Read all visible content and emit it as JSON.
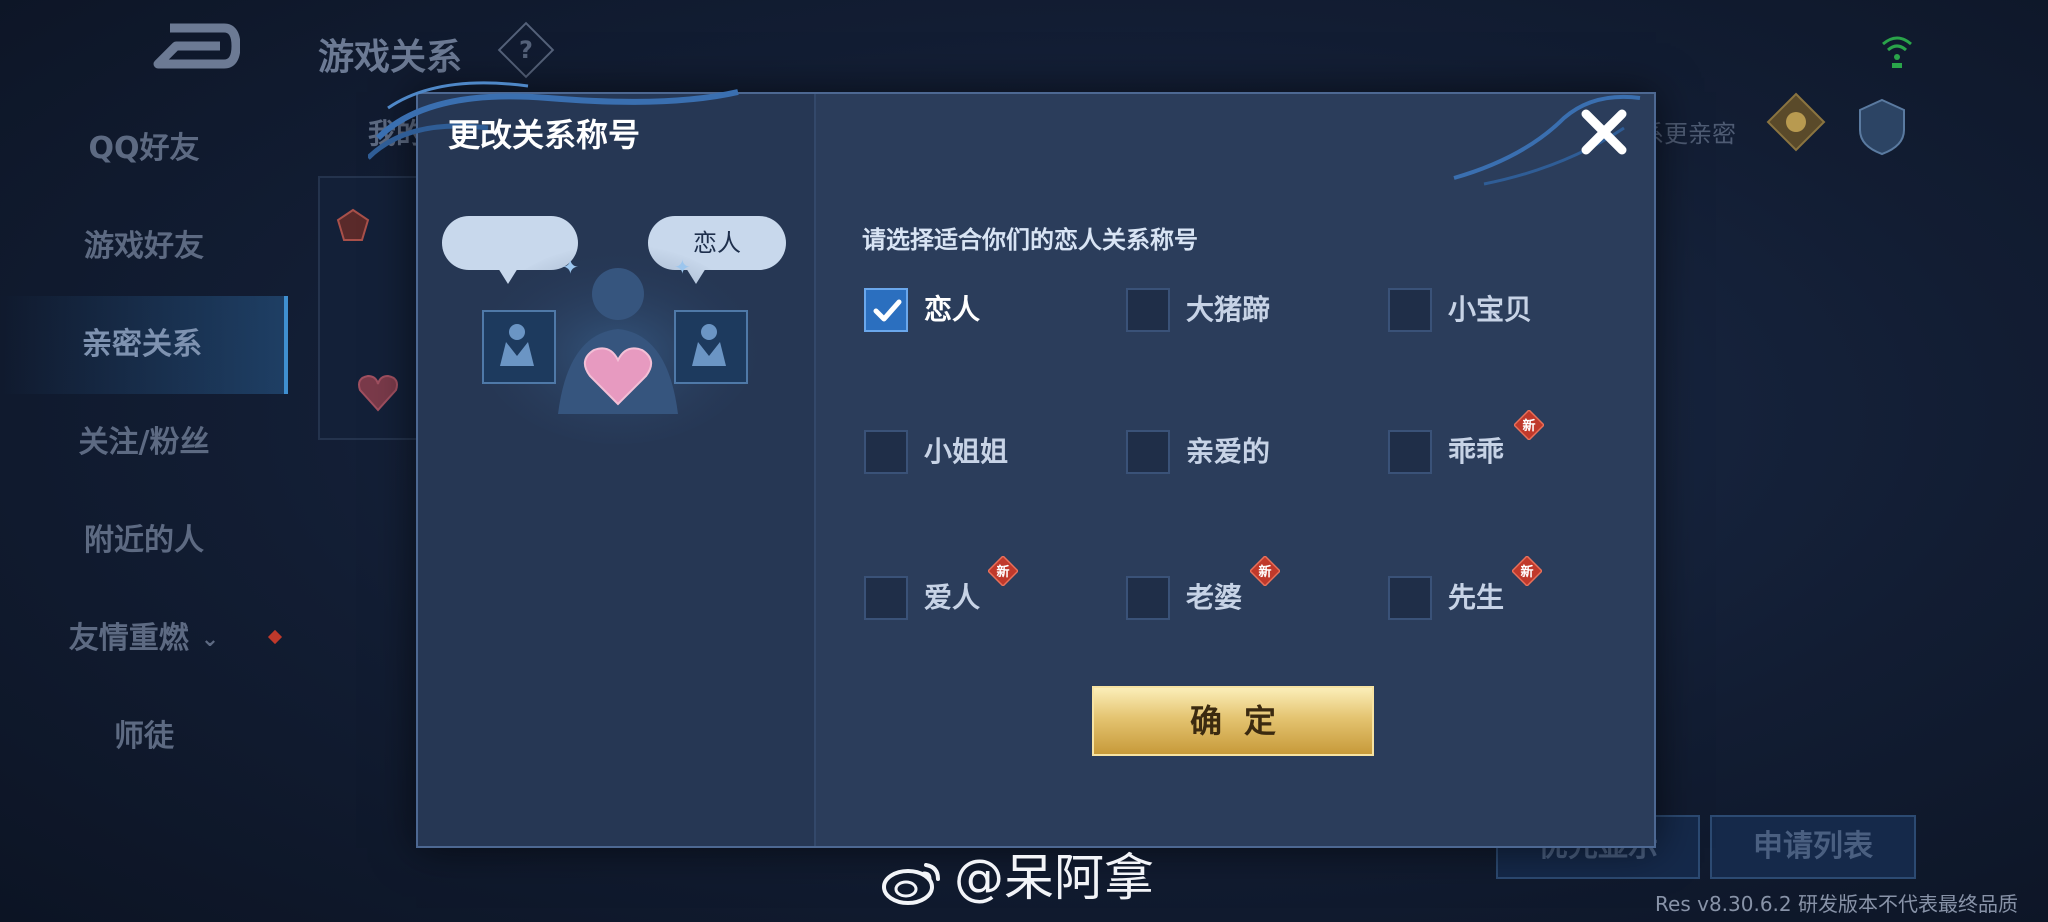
{
  "background": {
    "title": "游戏关系",
    "help_icon": "?",
    "sidebar": [
      {
        "label": "QQ好友",
        "active": false
      },
      {
        "label": "游戏好友",
        "active": false
      },
      {
        "label": "亲密关系",
        "active": true
      },
      {
        "label": "关注/粉丝",
        "active": false
      },
      {
        "label": "附近的人",
        "active": false
      },
      {
        "label": "友情重燃",
        "active": false
      },
      {
        "label": "师徒",
        "active": false
      }
    ],
    "sidebar_expand_glyph": "⌄",
    "tab_partial": "我的",
    "right_partial_text": "系更亲密",
    "buttons": {
      "priority": "优先显示",
      "apply_list": "申请列表"
    }
  },
  "modal": {
    "title": "更改关系称号",
    "close_icon": "close-icon",
    "bubble_right_label": "恋人",
    "prompt": "请选择适合你们的恋人关系称号",
    "new_badge_text": "新",
    "options": [
      {
        "label": "恋人",
        "checked": true,
        "is_new": false
      },
      {
        "label": "大猪蹄",
        "checked": false,
        "is_new": false
      },
      {
        "label": "小宝贝",
        "checked": false,
        "is_new": false
      },
      {
        "label": "小姐姐",
        "checked": false,
        "is_new": false
      },
      {
        "label": "亲爱的",
        "checked": false,
        "is_new": false
      },
      {
        "label": "乖乖",
        "checked": false,
        "is_new": true
      },
      {
        "label": "爱人",
        "checked": false,
        "is_new": true
      },
      {
        "label": "老婆",
        "checked": false,
        "is_new": true
      },
      {
        "label": "先生",
        "checked": false,
        "is_new": true
      }
    ],
    "confirm_label": "确定"
  },
  "watermark": "@呆阿拿",
  "version": "Res v8.30.6.2 研发版本不代表最终品质",
  "colors": {
    "accent": "#2b6fbf",
    "gold": "#e4c471",
    "new_badge": "#c0392b"
  }
}
